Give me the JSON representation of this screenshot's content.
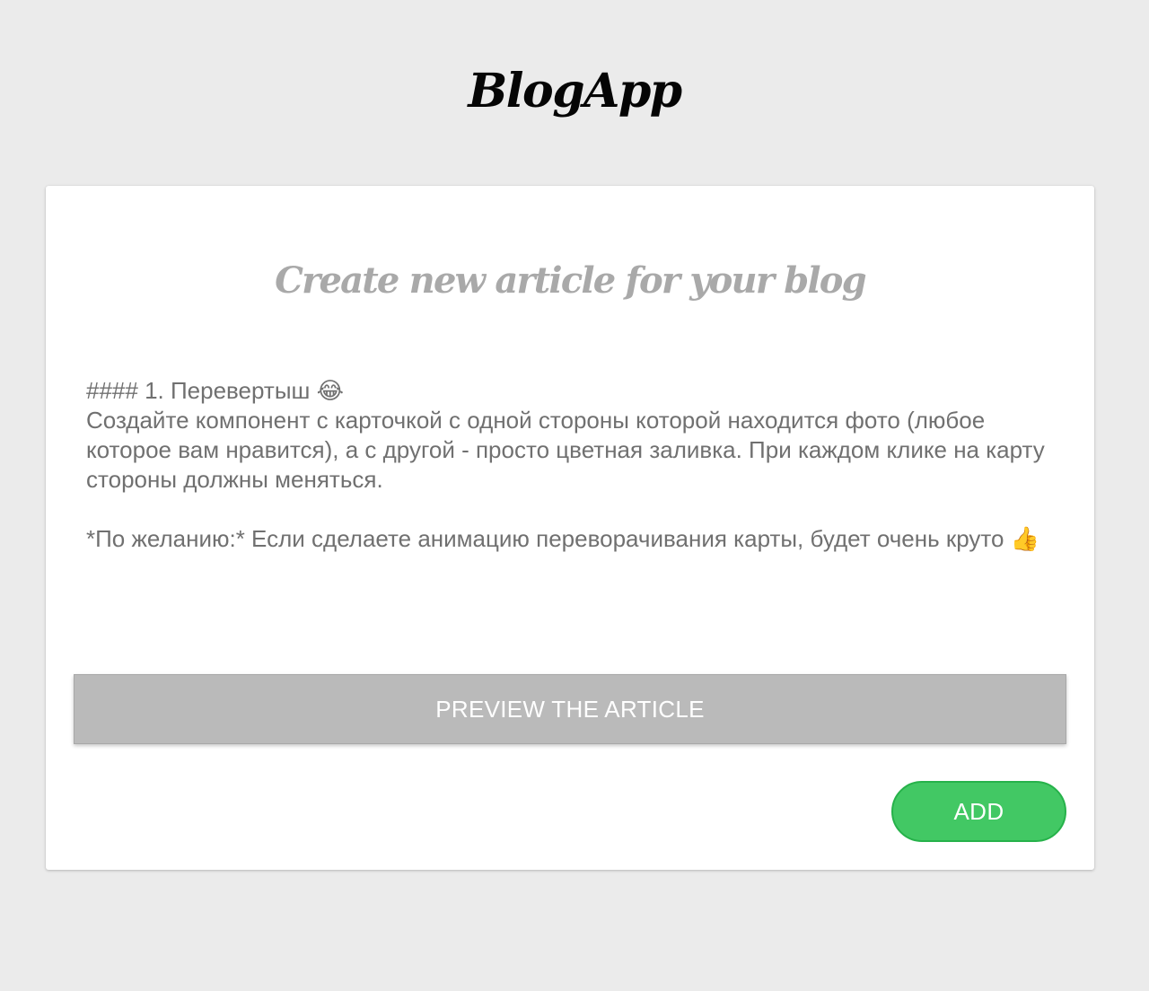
{
  "app": {
    "title": "BlogApp"
  },
  "editor_card": {
    "heading": "Create new article for your blog",
    "article_text": "#### 1. Перевертыш 😂\nСоздайте компонент с карточкой с одной стороны которой находится фото (любое которое вам нравится), а с другой - просто цветная заливка. При каждом клике на карту стороны должны меняться.\n\n*По желанию:* Если сделаете анимацию переворачивания карты, будет очень круто 👍",
    "preview_label": "PREVIEW THE ARTICLE",
    "add_label": "ADD"
  },
  "colors": {
    "page_background": "#ebebeb",
    "card_background": "#ffffff",
    "heading_text": "#a9a9a9",
    "body_text": "#707070",
    "preview_button": "#bababa",
    "add_button": "#42c864"
  }
}
